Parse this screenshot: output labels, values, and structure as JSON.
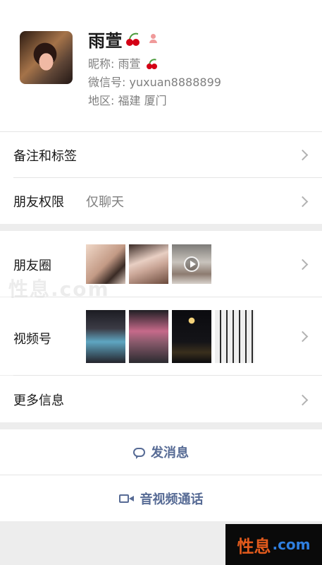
{
  "profile": {
    "name": "雨萱",
    "nickname_label": "昵称:",
    "nickname": "雨萱",
    "wechat_id_label": "微信号:",
    "wechat_id": "yuxuan8888899",
    "region_label": "地区:",
    "region": "福建 厦门"
  },
  "rows": {
    "remarks_tags": "备注和标签",
    "friend_permissions": "朋友权限",
    "friend_permissions_value": "仅聊天",
    "moments": "朋友圈",
    "channels": "视频号",
    "more_info": "更多信息"
  },
  "actions": {
    "send_message": "发消息",
    "video_call": "音视频通话"
  },
  "watermark": "性息.com",
  "brand": {
    "part1": "性息",
    "part2": ".com"
  },
  "colors": {
    "link_blue": "#576b95",
    "background": "#ededed"
  }
}
